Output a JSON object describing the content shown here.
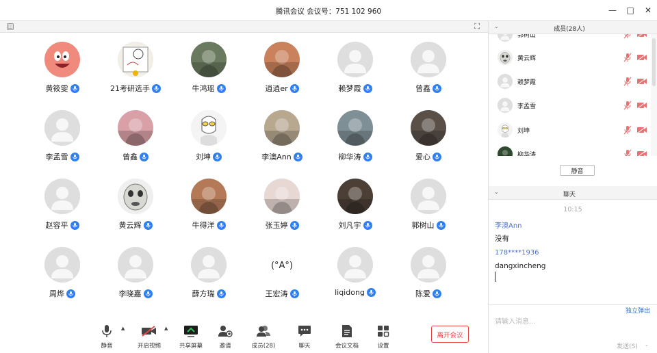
{
  "window": {
    "title": "腾讯会议 会议号：751 102 960",
    "minimize": "—",
    "maximize": "□",
    "close": "✕"
  },
  "view": {
    "fullscreen_glyph": "⛶",
    "toggle_glyph": "◫"
  },
  "participants": [
    {
      "name": "黄筱雯",
      "avatar": "patrick-star-avatar",
      "color": "#f08a7c"
    },
    {
      "name": "21考研选手",
      "avatar": "cartoon-sketch-avatar",
      "color": "#f2eee8"
    },
    {
      "name": "牛鸿瑶",
      "avatar": "landscape-photo-avatar",
      "color": "#6a7a5e"
    },
    {
      "name": "逍逍er",
      "avatar": "baby-photo-avatar",
      "color": "#c9825c"
    },
    {
      "name": "赖梦霞",
      "avatar": "default-avatar",
      "color": "#e0e0e0"
    },
    {
      "name": "曾鑫",
      "avatar": "default-avatar",
      "color": "#e0e0e0"
    },
    {
      "name": "李孟雪",
      "avatar": "default-avatar",
      "color": "#e0e0e0"
    },
    {
      "name": "曾鑫",
      "avatar": "pink-photo-avatar",
      "color": "#d9a0a8"
    },
    {
      "name": "刘坤",
      "avatar": "ultraman-avatar",
      "color": "#f4f4f4"
    },
    {
      "name": "李澳Ann",
      "avatar": "girl-photo-avatar",
      "color": "#b8a890"
    },
    {
      "name": "柳华涛",
      "avatar": "waterfall-photo-avatar",
      "color": "#7f8f96"
    },
    {
      "name": "爱心",
      "avatar": "dog-photo-avatar",
      "color": "#5a5048"
    },
    {
      "name": "赵容平",
      "avatar": "default-avatar",
      "color": "#e0e0e0"
    },
    {
      "name": "黄云辉",
      "avatar": "meme-face-avatar",
      "color": "#efefef"
    },
    {
      "name": "牛得洋",
      "avatar": "kid-photo-avatar",
      "color": "#b47a58"
    },
    {
      "name": "张玉婷",
      "avatar": "portrait-photo-avatar",
      "color": "#e8d8d4"
    },
    {
      "name": "刘凡宇",
      "avatar": "dark-photo-avatar",
      "color": "#4b3f36"
    },
    {
      "name": "郭树山",
      "avatar": "default-avatar",
      "color": "#e0e0e0"
    },
    {
      "name": "周烨",
      "avatar": "default-avatar",
      "color": "#e0e0e0"
    },
    {
      "name": "李晓嘉",
      "avatar": "default-avatar",
      "color": "#e0e0e0"
    },
    {
      "name": "薛方瑞",
      "avatar": "default-avatar",
      "color": "#e0e0e0"
    },
    {
      "name": "王宏涛",
      "avatar": "kaomoji-avatar",
      "color": "#ffffff"
    },
    {
      "name": "liqidong",
      "avatar": "default-avatar",
      "color": "#e0e0e0"
    },
    {
      "name": "陈爱",
      "avatar": "default-avatar",
      "color": "#e0e0e0"
    }
  ],
  "toolbar": {
    "mute": "静音",
    "video": "开启视频",
    "share": "共享屏幕",
    "invite": "邀请",
    "members": "成员(28)",
    "chat": "聊天",
    "docs": "会议文档",
    "settings": "设置",
    "leave": "离开会议"
  },
  "members_panel": {
    "title": "成员(28人)",
    "rows": [
      {
        "name": "郭树山",
        "avatar": "default-avatar"
      },
      {
        "name": "黄云辉",
        "avatar": "meme-face-avatar"
      },
      {
        "name": "赖梦霞",
        "avatar": "default-avatar"
      },
      {
        "name": "李孟雪",
        "avatar": "default-avatar"
      },
      {
        "name": "刘坤",
        "avatar": "ultraman-avatar"
      },
      {
        "name": "柳华涛",
        "avatar": "waterfall-photo-avatar"
      }
    ],
    "mute_all": "静音"
  },
  "chat_panel": {
    "title": "聊天",
    "time": "10:15",
    "messages": [
      {
        "sender": "李澳Ann",
        "text": "没有"
      },
      {
        "sender": "178****1936",
        "text": "dangxincheng"
      }
    ],
    "popout": "独立弹出",
    "placeholder": "请输入消息...",
    "send": "发送(S)"
  }
}
